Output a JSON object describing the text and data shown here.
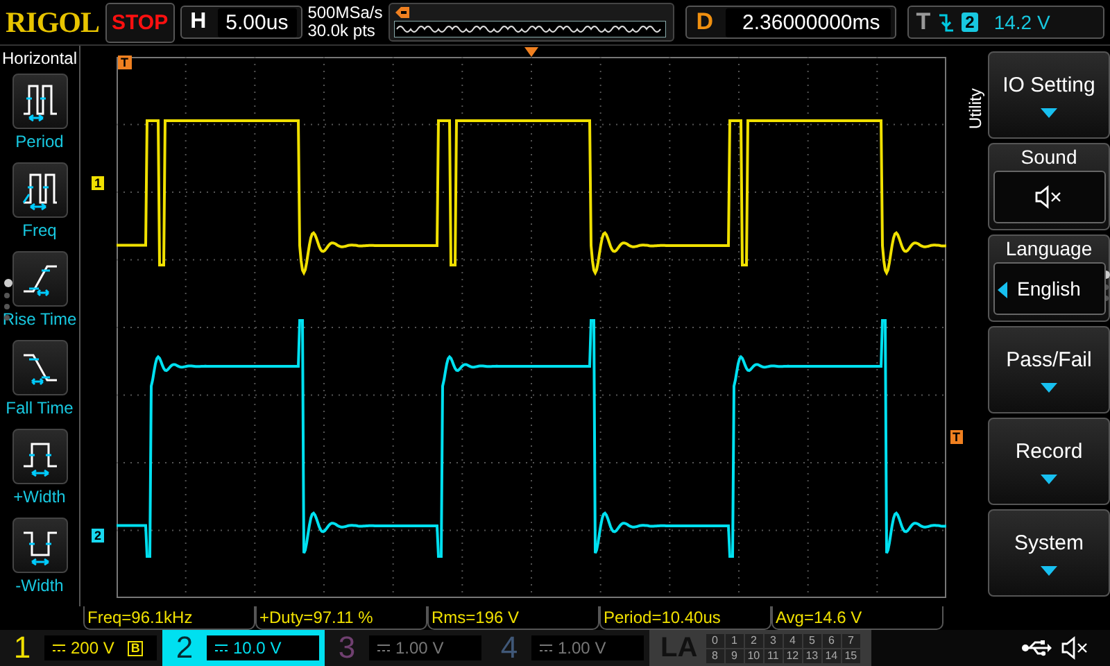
{
  "top_bar": {
    "logo": "RIGOL",
    "run_state": "STOP",
    "timebase": {
      "label": "H",
      "value": "5.00us"
    },
    "sample_rate": "500MSa/s",
    "memory_depth": "30.0k pts",
    "delay": {
      "label": "D",
      "value": "2.36000000ms"
    },
    "trigger": {
      "label": "T",
      "source": "2",
      "level": "14.2 V"
    }
  },
  "left_menu": {
    "title": "Horizontal",
    "items": [
      {
        "kind": "period",
        "label": "Period"
      },
      {
        "kind": "freq",
        "label": "Freq"
      },
      {
        "kind": "rise",
        "label": "Rise Time"
      },
      {
        "kind": "fall",
        "label": "Fall Time"
      },
      {
        "kind": "pwidth",
        "label": "+Width"
      },
      {
        "kind": "nwidth",
        "label": "-Width"
      }
    ],
    "pages": [
      {
        "selected": true
      },
      {
        "selected": false
      },
      {
        "selected": false
      },
      {
        "selected": false
      }
    ]
  },
  "markers": {
    "channel_1": "1",
    "channel_2": "2",
    "trigger_left": "T",
    "trigger_right": "T"
  },
  "right_menu": {
    "title": "Utility",
    "items": [
      {
        "kind": "submenu",
        "label": "IO Setting"
      },
      {
        "kind": "sound",
        "label": "Sound",
        "muted": true
      },
      {
        "kind": "select",
        "label": "Language",
        "value": "English"
      },
      {
        "kind": "submenu",
        "label": "Pass/Fail"
      },
      {
        "kind": "submenu",
        "label": "Record"
      },
      {
        "kind": "submenu",
        "label": "System"
      }
    ],
    "pages": [
      {
        "selected": true
      },
      {
        "selected": false
      },
      {
        "selected": false
      }
    ]
  },
  "measurements": [
    "Freq=96.1kHz",
    "+Duty=97.11 %",
    "Rms=196 V",
    "Period=10.40us",
    "Avg=14.6 V"
  ],
  "channels": [
    {
      "number": "1",
      "scale": "200 V",
      "badge": "B",
      "color": "#f0e000",
      "on": true,
      "selected": false
    },
    {
      "number": "2",
      "scale": "10.0 V",
      "color": "#00e0f0",
      "on": true,
      "selected": true
    },
    {
      "number": "3",
      "scale": "1.00 V",
      "color": "#704070",
      "on": false,
      "selected": false
    },
    {
      "number": "4",
      "scale": "1.00 V",
      "color": "#405878",
      "on": false,
      "selected": false
    }
  ],
  "logic_analyzer": {
    "label": "LA",
    "bits": [
      "0",
      "1",
      "2",
      "3",
      "4",
      "5",
      "6",
      "7",
      "8",
      "9",
      "10",
      "11",
      "12",
      "13",
      "14",
      "15"
    ]
  },
  "status": {
    "sound_muted": true
  }
}
